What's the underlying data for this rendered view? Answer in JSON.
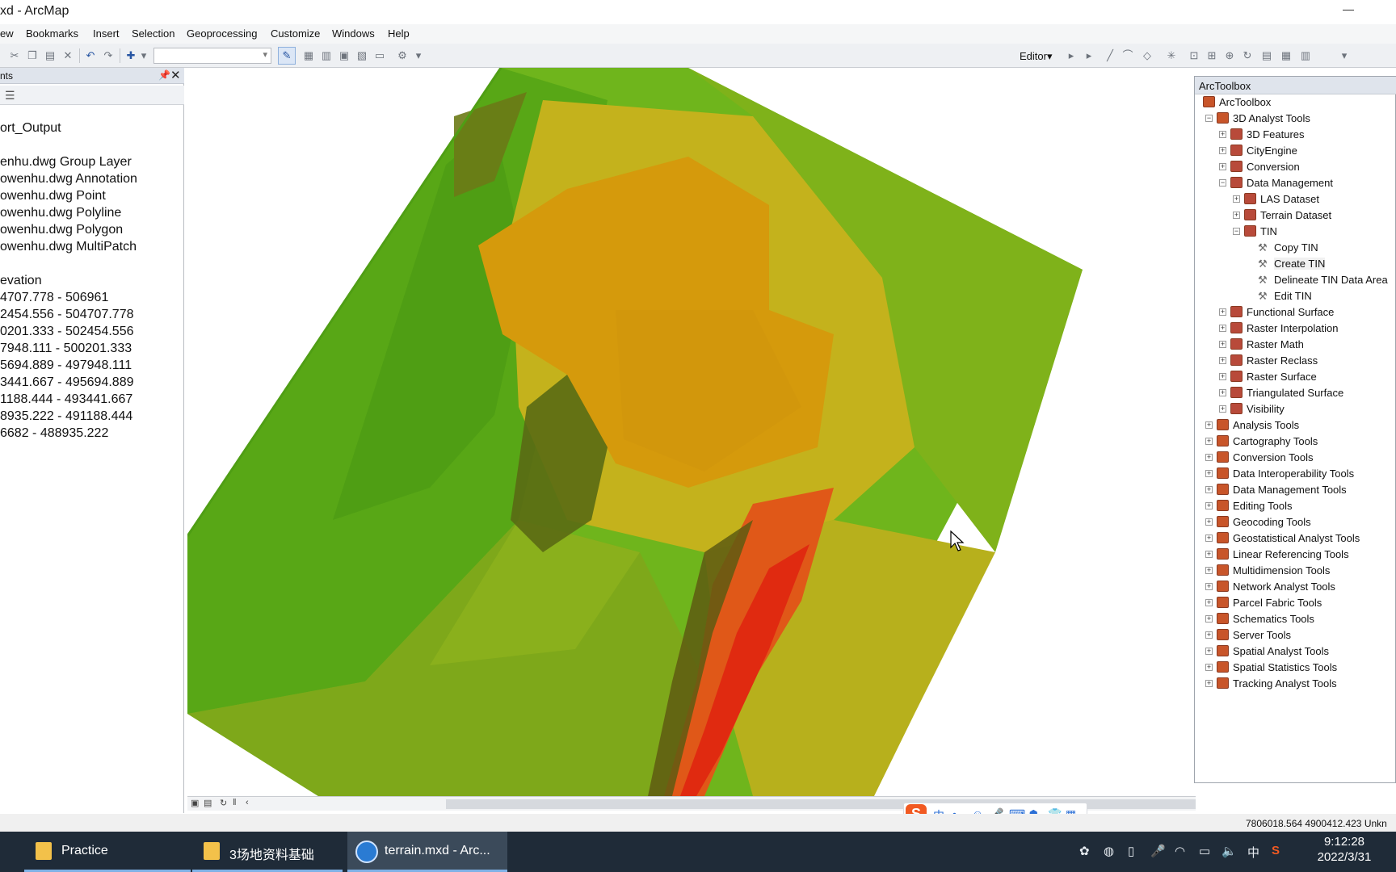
{
  "window": {
    "title": "xd - ArcMap"
  },
  "menu": [
    "ew",
    "Bookmarks",
    "Insert",
    "Selection",
    "Geoprocessing",
    "Customize",
    "Windows",
    "Help"
  ],
  "toolbar": {
    "editor_label": "Editor▾"
  },
  "toc": {
    "header": "nts",
    "items": [
      "ort_Output",
      "enhu.dwg Group Layer",
      "owenhu.dwg Annotation",
      "owenhu.dwg Point",
      "owenhu.dwg Polyline",
      "owenhu.dwg Polygon",
      "owenhu.dwg MultiPatch",
      "evation",
      "4707.778 - 506961",
      "2454.556 - 504707.778",
      "0201.333 - 502454.556",
      "7948.111 - 500201.333",
      "5694.889 - 497948.111",
      "3441.667 - 495694.889",
      "1188.444 - 493441.667",
      "8935.222 - 491188.444",
      "6682 - 488935.222"
    ]
  },
  "toolbox": {
    "title": "ArcToolbox",
    "tree": [
      {
        "label": "ArcToolbox",
        "level": 0,
        "type": "root",
        "exp": ""
      },
      {
        "label": "3D Analyst Tools",
        "level": 1,
        "type": "box",
        "exp": "−"
      },
      {
        "label": "3D Features",
        "level": 2,
        "type": "set",
        "exp": "+"
      },
      {
        "label": "CityEngine",
        "level": 2,
        "type": "set",
        "exp": "+"
      },
      {
        "label": "Conversion",
        "level": 2,
        "type": "set",
        "exp": "+"
      },
      {
        "label": "Data Management",
        "level": 2,
        "type": "set",
        "exp": "−"
      },
      {
        "label": "LAS Dataset",
        "level": 3,
        "type": "set",
        "exp": "+"
      },
      {
        "label": "Terrain Dataset",
        "level": 3,
        "type": "set",
        "exp": "+"
      },
      {
        "label": "TIN",
        "level": 3,
        "type": "set",
        "exp": "−"
      },
      {
        "label": "Copy TIN",
        "level": 4,
        "type": "tool",
        "exp": ""
      },
      {
        "label": "Create TIN",
        "level": 4,
        "type": "tool",
        "exp": "",
        "highlight": true
      },
      {
        "label": "Delineate TIN Data Area",
        "level": 4,
        "type": "tool",
        "exp": ""
      },
      {
        "label": "Edit TIN",
        "level": 4,
        "type": "tool",
        "exp": ""
      },
      {
        "label": "Functional Surface",
        "level": 2,
        "type": "set",
        "exp": "+"
      },
      {
        "label": "Raster Interpolation",
        "level": 2,
        "type": "set",
        "exp": "+"
      },
      {
        "label": "Raster Math",
        "level": 2,
        "type": "set",
        "exp": "+"
      },
      {
        "label": "Raster Reclass",
        "level": 2,
        "type": "set",
        "exp": "+"
      },
      {
        "label": "Raster Surface",
        "level": 2,
        "type": "set",
        "exp": "+"
      },
      {
        "label": "Triangulated Surface",
        "level": 2,
        "type": "set",
        "exp": "+"
      },
      {
        "label": "Visibility",
        "level": 2,
        "type": "set",
        "exp": "+"
      },
      {
        "label": "Analysis Tools",
        "level": 1,
        "type": "box",
        "exp": "+"
      },
      {
        "label": "Cartography Tools",
        "level": 1,
        "type": "box",
        "exp": "+"
      },
      {
        "label": "Conversion Tools",
        "level": 1,
        "type": "box",
        "exp": "+"
      },
      {
        "label": "Data Interoperability Tools",
        "level": 1,
        "type": "box",
        "exp": "+"
      },
      {
        "label": "Data Management Tools",
        "level": 1,
        "type": "box",
        "exp": "+"
      },
      {
        "label": "Editing Tools",
        "level": 1,
        "type": "box",
        "exp": "+"
      },
      {
        "label": "Geocoding Tools",
        "level": 1,
        "type": "box",
        "exp": "+"
      },
      {
        "label": "Geostatistical Analyst Tools",
        "level": 1,
        "type": "box",
        "exp": "+"
      },
      {
        "label": "Linear Referencing Tools",
        "level": 1,
        "type": "box",
        "exp": "+"
      },
      {
        "label": "Multidimension Tools",
        "level": 1,
        "type": "box",
        "exp": "+"
      },
      {
        "label": "Network Analyst Tools",
        "level": 1,
        "type": "box",
        "exp": "+"
      },
      {
        "label": "Parcel Fabric Tools",
        "level": 1,
        "type": "box",
        "exp": "+"
      },
      {
        "label": "Schematics Tools",
        "level": 1,
        "type": "box",
        "exp": "+"
      },
      {
        "label": "Server Tools",
        "level": 1,
        "type": "box",
        "exp": "+"
      },
      {
        "label": "Spatial Analyst Tools",
        "level": 1,
        "type": "box",
        "exp": "+"
      },
      {
        "label": "Spatial Statistics Tools",
        "level": 1,
        "type": "box",
        "exp": "+"
      },
      {
        "label": "Tracking Analyst Tools",
        "level": 1,
        "type": "box",
        "exp": "+"
      }
    ]
  },
  "status": {
    "coords": "7806018.564  4900412.423 Unkn"
  },
  "taskbar": {
    "tasks": [
      "Practice",
      "3场地资料基础",
      "terrain.mxd - Arc..."
    ],
    "time": "9:12:28",
    "date": "2022/3/31",
    "ime_label": "中"
  },
  "colors": {
    "terrain_green": "#6fb51c",
    "terrain_yellow": "#c7b21a",
    "terrain_orange": "#d59a0c",
    "terrain_red": "#e03a10",
    "taskbar_bg": "#1f2b38"
  }
}
